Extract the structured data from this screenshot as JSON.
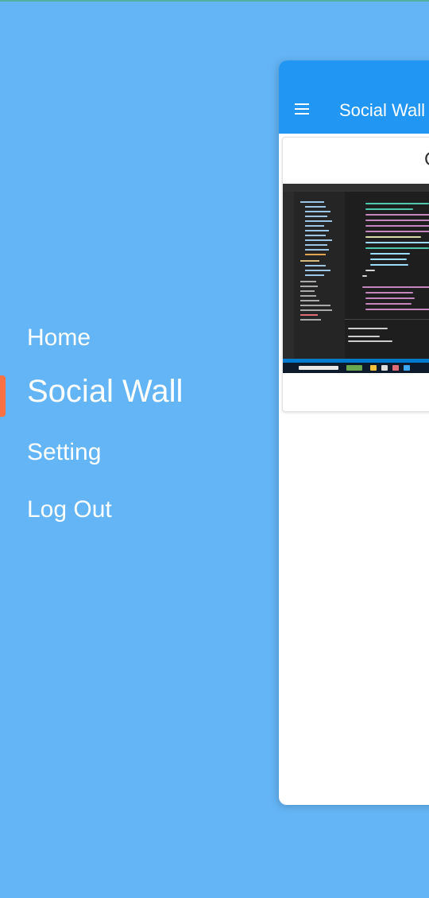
{
  "drawer": {
    "items": [
      {
        "label": "Home"
      },
      {
        "label": "Social Wall"
      },
      {
        "label": "Setting"
      },
      {
        "label": "Log Out"
      }
    ],
    "active_index": 1
  },
  "app": {
    "title": "Social Wall"
  },
  "post": {
    "header_text": "C"
  },
  "colors": {
    "background": "#64b5f6",
    "app_bar": "#2196f3",
    "active_indicator": "#ff7043",
    "menu_text": "#ffffff"
  },
  "icons": [
    "menu-icon"
  ]
}
